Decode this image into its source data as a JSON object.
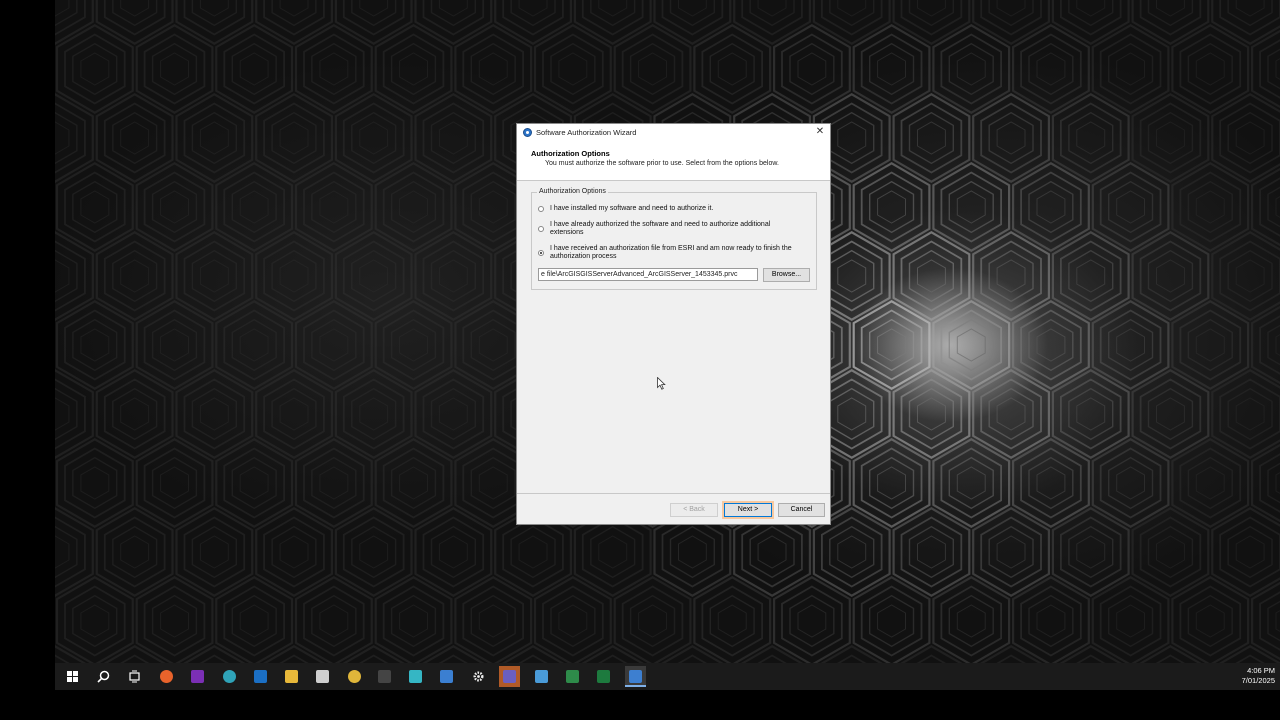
{
  "dialog": {
    "title": "Software Authorization Wizard",
    "header_title": "Authorization Options",
    "header_desc": "You must authorize the software prior to use. Select from the options below.",
    "group_label": "Authorization Options",
    "options": [
      {
        "label": "I have installed my software and need to authorize it.",
        "selected": false
      },
      {
        "label": "I have already authorized the software and need to authorize additional extensions",
        "selected": false
      },
      {
        "label": "I have received an authorization file from ESRI and am now ready to finish the authorization process",
        "selected": true
      }
    ],
    "file_path": "e file\\ArcGISGISServerAdvanced_ArcGISServer_1453345.prvc",
    "browse_label": "Browse...",
    "back_label": "< Back",
    "next_label": "Next >",
    "cancel_label": "Cancel",
    "close_glyph": "✕"
  },
  "taskbar": {
    "time": "4:06 PM",
    "date": "7/01/2025",
    "icons": [
      {
        "name": "start-icon",
        "color": "#ffffff"
      },
      {
        "name": "search-icon",
        "color": "#ffffff"
      },
      {
        "name": "task-view-icon",
        "color": "#ffffff"
      },
      {
        "name": "firefox-icon",
        "color": "#e8632b"
      },
      {
        "name": "onenote-icon",
        "color": "#7b2fb5"
      },
      {
        "name": "edge-icon",
        "color": "#2fa3b8"
      },
      {
        "name": "outlook-icon",
        "color": "#1b6fc4"
      },
      {
        "name": "file-explorer-icon",
        "color": "#e8b83a"
      },
      {
        "name": "settings-tool-icon",
        "color": "#cfcfcf"
      },
      {
        "name": "chrome-icon",
        "color": "#e0b63a"
      },
      {
        "name": "terminal-icon",
        "color": "#444444"
      },
      {
        "name": "cube-app-icon",
        "color": "#35b6c4"
      },
      {
        "name": "arcgis-pro-icon",
        "color": "#3b7fd1"
      },
      {
        "name": "gear-icon",
        "color": "#dddddd"
      },
      {
        "name": "teams-icon",
        "color": "#6a5fc1"
      },
      {
        "name": "map-app-icon",
        "color": "#4a9bd8"
      },
      {
        "name": "excel-chart-icon",
        "color": "#2e8b4a"
      },
      {
        "name": "excel-icon",
        "color": "#1d7a3e"
      },
      {
        "name": "authorization-wizard-icon",
        "color": "#3d7fd0"
      }
    ]
  }
}
